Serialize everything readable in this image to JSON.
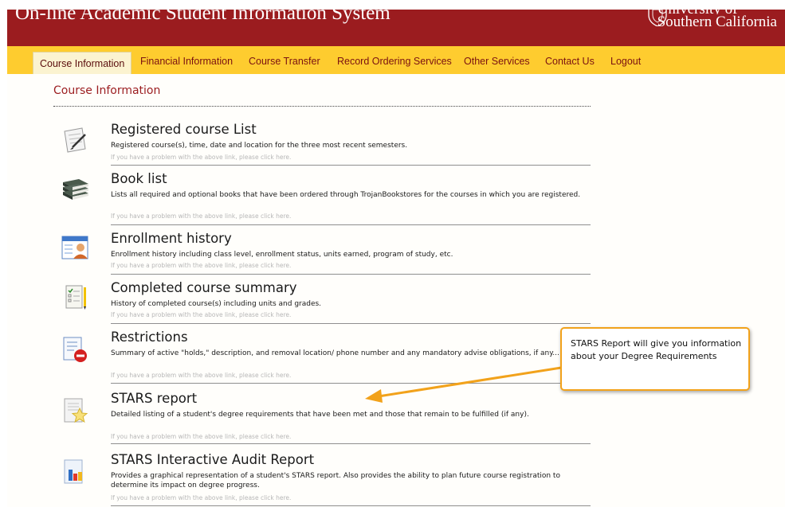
{
  "header": {
    "title": "On-line Academic Student Information System",
    "university_line1": "University of",
    "university_line2": "Southern California"
  },
  "nav": {
    "items": [
      {
        "label": "Course Information"
      },
      {
        "label": "Financial Information"
      },
      {
        "label": "Course Transfer"
      },
      {
        "label": "Record Ordering Services"
      },
      {
        "label": "Other Services"
      },
      {
        "label": "Contact Us"
      },
      {
        "label": "Logout"
      }
    ]
  },
  "section_title": "Course Information",
  "help_text": "If you have a problem with the above link, please click here.",
  "items": [
    {
      "title": "Registered course List",
      "desc": "Registered course(s), time, date and location for the three most recent semesters.",
      "icon": "registered-course-list-icon"
    },
    {
      "title": "Book list",
      "desc": "Lists all required and optional books that have been ordered through TrojanBookstores for the courses in which you are registered.",
      "icon": "book-list-icon"
    },
    {
      "title": "Enrollment history",
      "desc": "Enrollment history including class level, enrollment status, units earned, program of study, etc.",
      "icon": "enrollment-history-icon"
    },
    {
      "title": "Completed course summary",
      "desc": "History of completed course(s) including units and grades.",
      "icon": "completed-course-summary-icon"
    },
    {
      "title": "Restrictions",
      "desc": "Summary of active \"holds,\" description, and removal location/ phone number and any mandatory advise obligations, if any...",
      "icon": "restrictions-icon"
    },
    {
      "title": "STARS report",
      "desc": "Detailed listing of a student's degree requirements that have been met and those that remain to be fulfilled (if any).",
      "icon": "stars-report-icon"
    },
    {
      "title": "STARS Interactive Audit Report",
      "desc": "Provides a graphical representation of a student's STARS report. Also provides the ability to plan future course registration to determine its impact on degree progress.",
      "icon": "stars-interactive-audit-report-icon"
    }
  ],
  "callout": {
    "text": "STARS Report will give you information about your Degree Requirements"
  },
  "colors": {
    "header_red": "#9b1c1f",
    "nav_gold": "#fecc2f",
    "callout_orange": "#f2a21b"
  }
}
